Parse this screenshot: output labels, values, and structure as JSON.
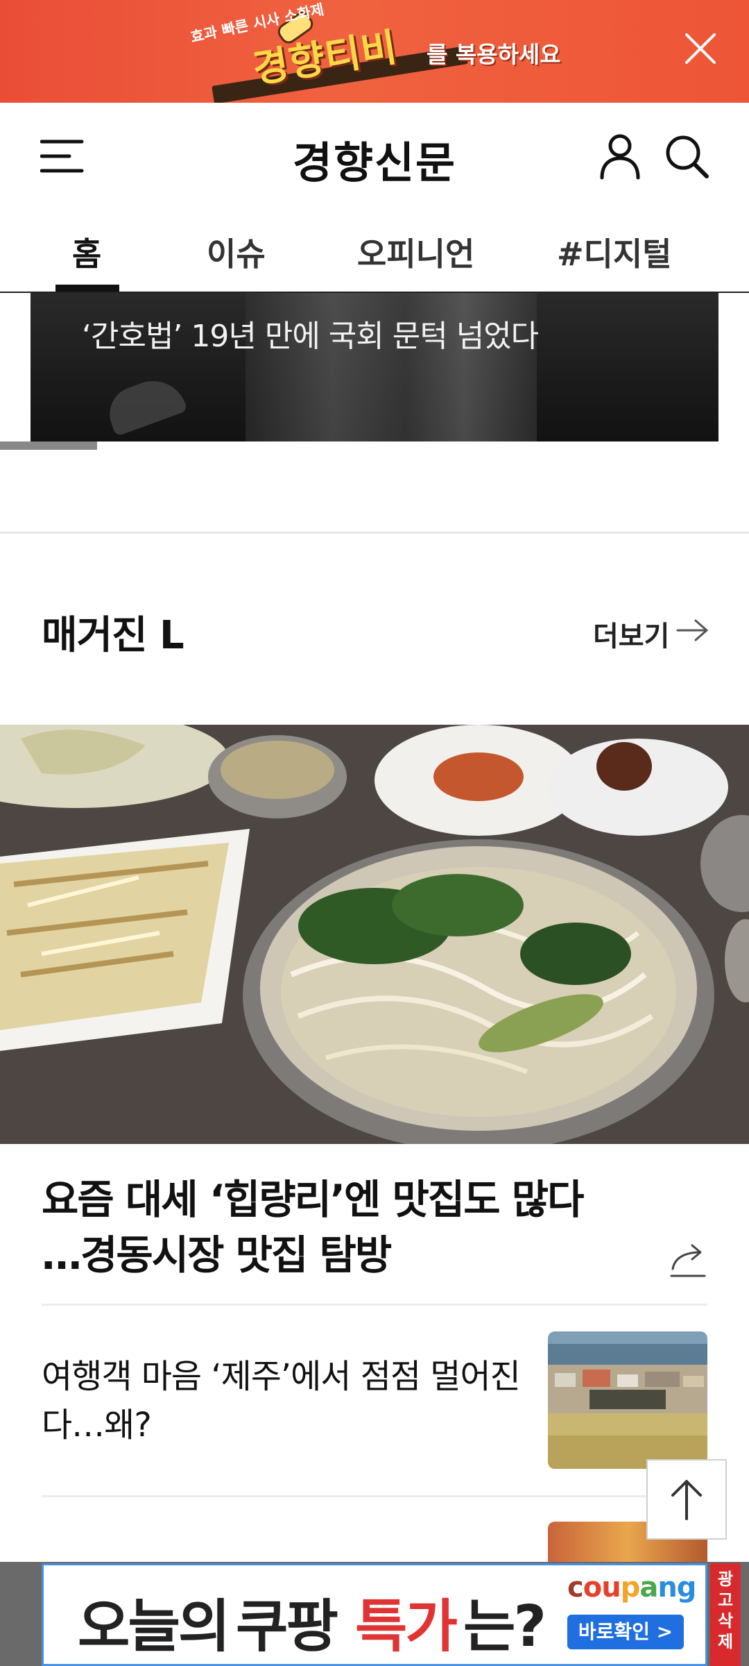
{
  "top_ad": {
    "small_text": "효과 빠른 시사 소화제",
    "brand": "경향티비",
    "tail": "를 복용하세요",
    "close_icon": "close-icon"
  },
  "header": {
    "logo": "경향신문",
    "menu_icon": "hamburger-menu-icon",
    "user_icon": "user-icon",
    "search_icon": "search-icon"
  },
  "nav": {
    "tabs": [
      {
        "label": "홈",
        "active": true
      },
      {
        "label": "이슈",
        "active": false
      },
      {
        "label": "오피니언",
        "active": false
      },
      {
        "label": "#디지털",
        "active": false
      }
    ]
  },
  "hero": {
    "title": "‘간호법’ 19년 만에 국회 문턱 넘었다"
  },
  "section": {
    "title": "매거진 L",
    "more_label": "더보기"
  },
  "feature": {
    "title": "요즘 대세 ‘힙량리’엔 맛집도 많다…경동시장 맛집 탐방"
  },
  "articles": [
    {
      "title": "여행객 마음 ‘제주’에서 점점 멀어진다…왜?"
    }
  ],
  "bottom_ad": {
    "text_1": "오늘의",
    "text_2": "쿠팡",
    "text_3": "특가",
    "text_4": "는?",
    "brand_letters": [
      "c",
      "ou",
      "p",
      "a",
      "ng"
    ],
    "cta": "바로확인 >",
    "remove_label": "광고삭제"
  },
  "colors": {
    "ad_orange": "#ea4d37",
    "accent_red": "#e03434",
    "coupang_blue": "#1f6fe0"
  }
}
